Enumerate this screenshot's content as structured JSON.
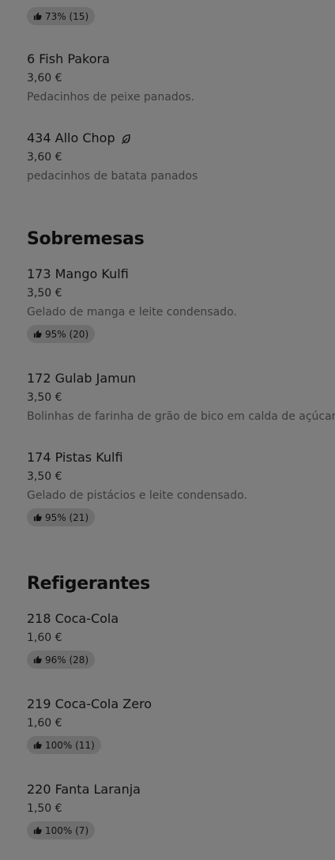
{
  "sections": [
    {
      "title": "Sobremesas"
    },
    {
      "title": "Refigerantes"
    }
  ],
  "top": {
    "rating_label": "73% (15)"
  },
  "items": [
    {
      "name": "6 Fish Pakora",
      "price": "3,60 €",
      "description": "Pedacinhos de peixe panados."
    },
    {
      "name": "434 Allo Chop",
      "price": "3,60 €",
      "description": "pedacinhos de batata panados",
      "icon": "leaf-icon"
    },
    {
      "name": "173 Mango Kulfi",
      "price": "3,50 €",
      "description": "Gelado de manga e leite condensado.",
      "rating": "95% (20)"
    },
    {
      "name": "172 Gulab Jamun",
      "price": "3,50 €",
      "description": "Bolinhas de farinha de grão de bico em calda de açúcar."
    },
    {
      "name": "174 Pistas Kulfi",
      "price": "3,50 €",
      "description": "Gelado de pistácios e leite condensado.",
      "rating": "95% (21)"
    },
    {
      "name": "218 Coca-Cola",
      "price": "1,60 €",
      "rating": "96% (28)"
    },
    {
      "name": "219 Coca-Cola Zero",
      "price": "1,60 €",
      "rating": "100% (11)"
    },
    {
      "name": "220 Fanta Laranja",
      "price": "1,50 €",
      "rating": "100% (7)"
    }
  ],
  "colors": {
    "overlay_background": "#7d7d7d",
    "rating_pill": "#6e6e6e"
  }
}
